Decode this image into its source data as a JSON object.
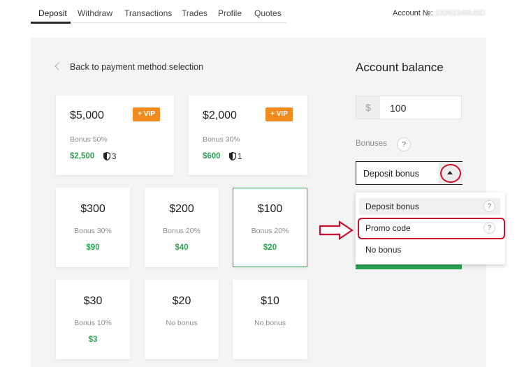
{
  "nav": {
    "tabs": [
      "Deposit",
      "Withdraw",
      "Transactions",
      "Trades",
      "Profile",
      "Quotes"
    ],
    "active": "Deposit",
    "account_label": "Account №:",
    "account_number": "23262348USD"
  },
  "back_link": "Back to payment method selection",
  "cards": [
    {
      "amount": "$5,000",
      "bonus": "Bonus 50%",
      "bonus_amount": "$2,500",
      "vip": "+ VIP",
      "shield_count": "3"
    },
    {
      "amount": "$2,000",
      "bonus": "Bonus 30%",
      "bonus_amount": "$600",
      "vip": "+ VIP",
      "shield_count": "1"
    },
    {
      "amount": "$300",
      "bonus": "Bonus 30%",
      "bonus_amount": "$90"
    },
    {
      "amount": "$200",
      "bonus": "Bonus 20%",
      "bonus_amount": "$40"
    },
    {
      "amount": "$100",
      "bonus": "Bonus 20%",
      "bonus_amount": "$20",
      "selected": true
    },
    {
      "amount": "$30",
      "bonus": "Bonus 10%",
      "bonus_amount": "$3"
    },
    {
      "amount": "$20",
      "bonus": "No bonus"
    },
    {
      "amount": "$10",
      "bonus": "No bonus"
    }
  ],
  "balance": {
    "title": "Account balance",
    "currency_symbol": "$",
    "amount": "100",
    "bonuses_label": "Bonuses",
    "help": "?",
    "selected_bonus": "Deposit bonus"
  },
  "dropdown": {
    "options": [
      "Deposit bonus",
      "Promo code",
      "No bonus"
    ],
    "help": "?"
  },
  "colors": {
    "accent_green": "#2aa44f",
    "vip_orange": "#f28b1e",
    "annotation_red": "#c8102e"
  }
}
